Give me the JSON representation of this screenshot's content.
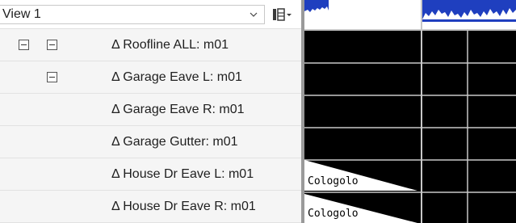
{
  "toolbar": {
    "view_value": "View 1",
    "dropdown_icon": "chevron-down-icon",
    "layout_icon": "split-layout-icon"
  },
  "tree": {
    "rows": [
      {
        "label": "Δ Roofline ALL: m01",
        "expander_l1": true,
        "expander_l2": true
      },
      {
        "label": "Δ Garage Eave L: m01",
        "expander_l1": false,
        "expander_l2": true
      },
      {
        "label": "Δ Garage Eave R: m01",
        "expander_l1": false,
        "expander_l2": false
      },
      {
        "label": "Δ Garage Gutter: m01",
        "expander_l1": false,
        "expander_l2": false
      },
      {
        "label": "Δ House Dr Eave L: m01",
        "expander_l1": false,
        "expander_l2": false
      },
      {
        "label": "Δ House Dr Eave R: m01",
        "expander_l1": false,
        "expander_l2": false
      }
    ]
  },
  "graph": {
    "overlay_text": "Cologolo",
    "colors": {
      "background": "#000000",
      "waveform": "#1f3fbf",
      "grid": "#c8c8c8",
      "wedge": "#ffffff"
    }
  }
}
